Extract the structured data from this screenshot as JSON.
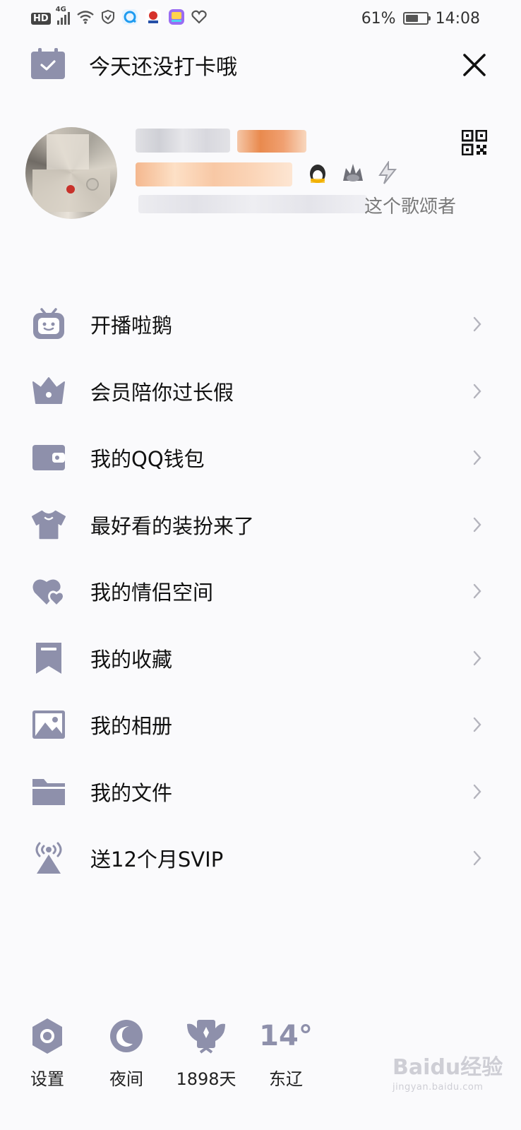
{
  "status_bar": {
    "left_badge": "HD",
    "network": "4G",
    "battery_percent": "61%",
    "battery_level": 0.61,
    "time": "14:08",
    "icons": [
      "hd-icon",
      "signal-icon",
      "wifi-icon",
      "vpn-shield-icon",
      "browser-app-icon",
      "news-app-icon",
      "gallery-app-icon",
      "heart-app-icon",
      "battery-icon"
    ]
  },
  "header": {
    "checkin_text": "今天还没打卡哦",
    "checkin_icon": "calendar-check-icon",
    "close_icon": "close-icon"
  },
  "profile": {
    "signature_suffix": "这个歌颂者",
    "qr_icon": "qr-code-icon",
    "badges": [
      "qq-penguin-icon",
      "level-crown-icon",
      "lightning-icon"
    ]
  },
  "menu": {
    "items": [
      {
        "label": "开播啦鹅",
        "icon": "tv-face-icon"
      },
      {
        "label": "会员陪你过长假",
        "icon": "crown-icon"
      },
      {
        "label": "我的QQ钱包",
        "icon": "wallet-icon"
      },
      {
        "label": "最好看的装扮来了",
        "icon": "tshirt-icon"
      },
      {
        "label": "我的情侣空间",
        "icon": "hearts-icon"
      },
      {
        "label": "我的收藏",
        "icon": "bookmark-icon"
      },
      {
        "label": "我的相册",
        "icon": "image-icon"
      },
      {
        "label": "我的文件",
        "icon": "folder-icon"
      },
      {
        "label": "送12个月SVIP",
        "icon": "broadcast-icon"
      }
    ]
  },
  "bottom_bar": {
    "settings": "设置",
    "night": "夜间",
    "days": "1898天",
    "temperature": "14°",
    "location": "东辽"
  },
  "watermark": {
    "main": "Baidu经验",
    "sub": "jingyan.baidu.com"
  },
  "colors": {
    "icon_gray": "#8e90ab",
    "background": "#fafafc",
    "text": "#111111",
    "chevron": "#b4b4bd"
  }
}
